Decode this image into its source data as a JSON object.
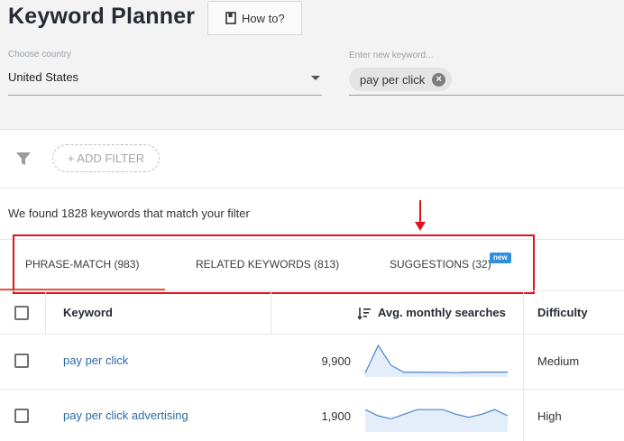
{
  "header": {
    "title": "Keyword Planner",
    "howto_label": "How to?",
    "country_label": "Choose country",
    "country_value": "United States",
    "keyword_label": "Enter new keyword...",
    "keyword_chip": "pay per click"
  },
  "filter": {
    "add_filter_label": "+ ADD FILTER"
  },
  "results": {
    "found_text": "We found 1828 keywords that match your filter"
  },
  "tabs": [
    {
      "label": "PHRASE-MATCH (983)",
      "active": true
    },
    {
      "label": "RELATED KEYWORDS (813)",
      "active": false
    },
    {
      "label": "SUGGESTIONS (32)",
      "active": false,
      "badge": "new"
    }
  ],
  "table": {
    "columns": {
      "keyword": "Keyword",
      "searches": "Avg. monthly searches",
      "difficulty": "Difficulty"
    },
    "rows": [
      {
        "keyword": "pay per click",
        "volume": "9,900",
        "difficulty": "Medium",
        "trend": [
          10,
          100,
          35,
          12,
          13,
          12,
          12,
          11,
          12,
          13,
          13,
          13
        ]
      },
      {
        "keyword": "pay per click advertising",
        "volume": "1,900",
        "difficulty": "High",
        "trend": [
          70,
          50,
          40,
          55,
          70,
          70,
          70,
          55,
          45,
          55,
          70,
          50
        ]
      }
    ]
  },
  "colors": {
    "accent": "#e35b3a",
    "link": "#2b6aa8",
    "highlight": "#e0131e",
    "badge": "#2f8fdd"
  }
}
